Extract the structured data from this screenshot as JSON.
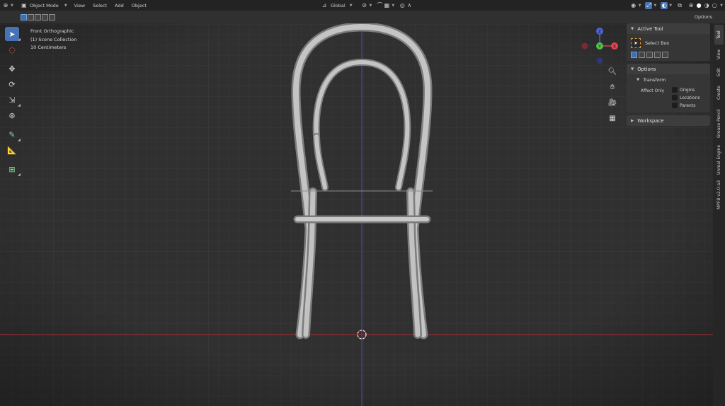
{
  "header": {
    "mode": "Object Mode",
    "menus": [
      "View",
      "Select",
      "Add",
      "Object"
    ],
    "orientation": "Global",
    "options_label": "Options"
  },
  "viewport": {
    "view_name": "Front Orthographic",
    "collection": "(1) Scene Collection",
    "scale": "10 Centimeters",
    "gizmo": {
      "z": "Z",
      "x": "X",
      "y": "Y"
    },
    "colors": {
      "background": "#303030",
      "x_axis": "#9b2c33",
      "z_axis": "#4a4ea8",
      "chair": "#b9b9b9"
    }
  },
  "toolbar": {
    "tools": [
      "select-box",
      "cursor",
      "move",
      "rotate",
      "scale",
      "transform",
      "annotate",
      "measure",
      "add-cube"
    ]
  },
  "side_panel": {
    "active_tool_title": "Active Tool",
    "active_tool_name": "Select Box",
    "options_title": "Options",
    "transform_title": "Transform",
    "affect_only": "Affect Only",
    "checks": [
      "Origins",
      "Locations",
      "Parents"
    ],
    "workspace_title": "Workspace"
  },
  "tabs": [
    "Tool",
    "View",
    "Edit",
    "Create",
    "Grease Pencil",
    "Unreal Engine",
    "MPFB v2.0-a3"
  ]
}
